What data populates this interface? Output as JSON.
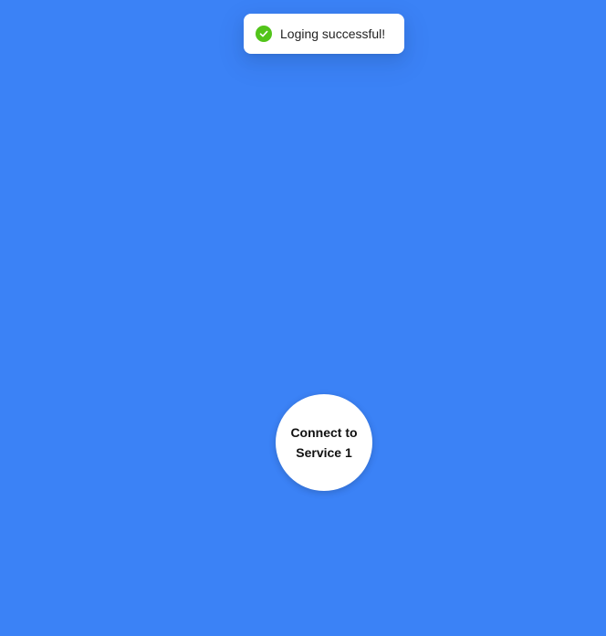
{
  "theme": {
    "background_color": "#3b82f6",
    "success_color": "#52c41a"
  },
  "toast": {
    "icon": "check-circle-icon",
    "message": "Loging successful!"
  },
  "main": {
    "connect_button_label": "Connect to Service 1"
  }
}
